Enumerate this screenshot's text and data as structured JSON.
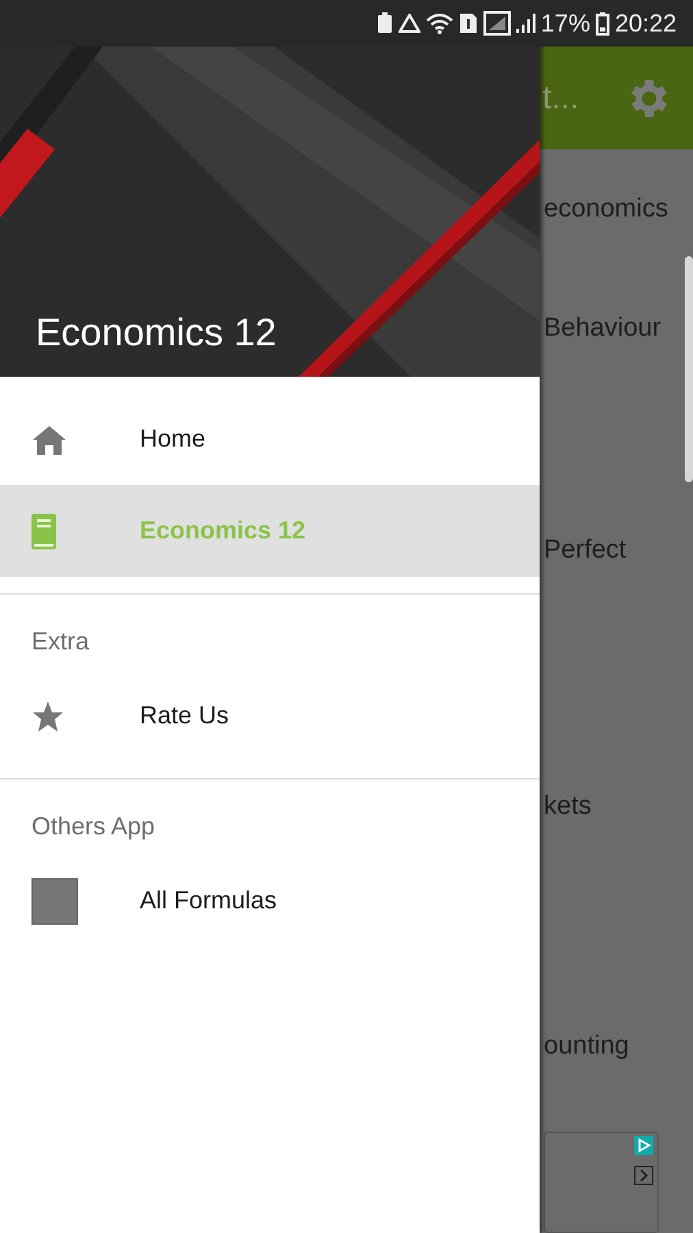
{
  "status_bar": {
    "battery": "17%",
    "time": "20:22"
  },
  "app_bar": {
    "title": "t..."
  },
  "content": {
    "items": [
      "economics",
      "Behaviour",
      "Perfect",
      "kets",
      "ounting"
    ]
  },
  "drawer": {
    "header_title": "Economics 12",
    "sections": [
      {
        "items": [
          {
            "label": "Home",
            "kind": "home",
            "selected": false
          },
          {
            "label": "Economics 12",
            "kind": "book",
            "selected": true
          }
        ]
      },
      {
        "heading": "Extra",
        "items": [
          {
            "label": "Rate Us",
            "kind": "star",
            "selected": false
          }
        ]
      },
      {
        "heading": "Others App",
        "items": [
          {
            "label": "All Formulas",
            "kind": "app",
            "selected": false
          }
        ]
      }
    ]
  }
}
